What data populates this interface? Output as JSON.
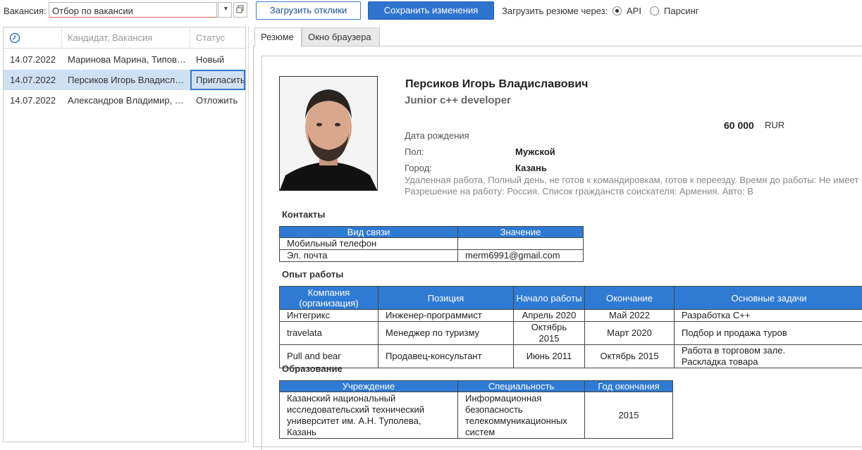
{
  "toolbar": {
    "vacancy_label": "Вакансия:",
    "vacancy_value": "Отбор по вакансии",
    "load_button": "Загрузить отклики",
    "save_button": "Сохранить изменения",
    "load_via_label": "Загрузить резюме через:",
    "option_api": "API",
    "option_parse": "Парсинг",
    "selected_option": "API"
  },
  "list": {
    "headers": {
      "candidate": "Кандидат, Вакансия",
      "status": "Статус"
    },
    "rows": [
      {
        "date": "14.07.2022",
        "candidate": "Маринова Марина, Типов…",
        "status": "Новый"
      },
      {
        "date": "14.07.2022",
        "candidate": "Персиков Игорь Владисл…",
        "status": "Пригласить"
      },
      {
        "date": "14.07.2022",
        "candidate": "Александров Владимир, …",
        "status": "Отложить"
      }
    ],
    "selected_index": 1
  },
  "tabs": [
    "Резюме",
    "Окно браузера"
  ],
  "resume": {
    "name": "Персиков Игорь Владиславович",
    "position": "Junior c++ developer",
    "salary": "60 000",
    "currency": "RUR",
    "birth_label": "Дата рождения",
    "gender_label": "Пол:",
    "gender": "Мужской",
    "city_label": "Город:",
    "city": "Казань",
    "note1": "Удаленная работа, Полный день, не готов к командировкам, готов к переезду. Время до работы: Не имеет значения",
    "note2": "Разрешение на работу: Россия. Список гражданств соискателя: Армения.  Авто: В",
    "contacts": {
      "title": "Контакты",
      "headers": [
        "Вид связи",
        "Значение"
      ],
      "rows": [
        [
          "Мобильный телефон",
          ""
        ],
        [
          "Эл. почта",
          "merm6991@gmail.com"
        ]
      ]
    },
    "experience": {
      "title": "Опыт работы",
      "headers": [
        "Компания\n(организация)",
        "Позиция",
        "Начало работы",
        "Окончание",
        "Основные задачи"
      ],
      "rows": [
        [
          "Интегрикс",
          "Инженер-программист",
          "Апрель 2020",
          "Май 2022",
          "Разработка С++"
        ],
        [
          "travelata",
          "Менеджер по туризму",
          "Октябрь 2015",
          "Март 2020",
          "Подбор и продажа туров"
        ],
        [
          "Pull and bear",
          "Продавец-консультант",
          "Июнь 2011",
          "Октябрь 2015",
          "Работа в торговом зале.\nРаскладка товара"
        ]
      ]
    },
    "education": {
      "title": "Образование",
      "headers": [
        "Учреждение",
        "Специальность",
        "Год окончания"
      ],
      "rows": [
        [
          "Казанский национальный исследовательский технический университет им. А.Н. Туполева, Казань",
          "Информационная безопасность телекоммуникационных систем",
          "2015"
        ]
      ]
    }
  }
}
